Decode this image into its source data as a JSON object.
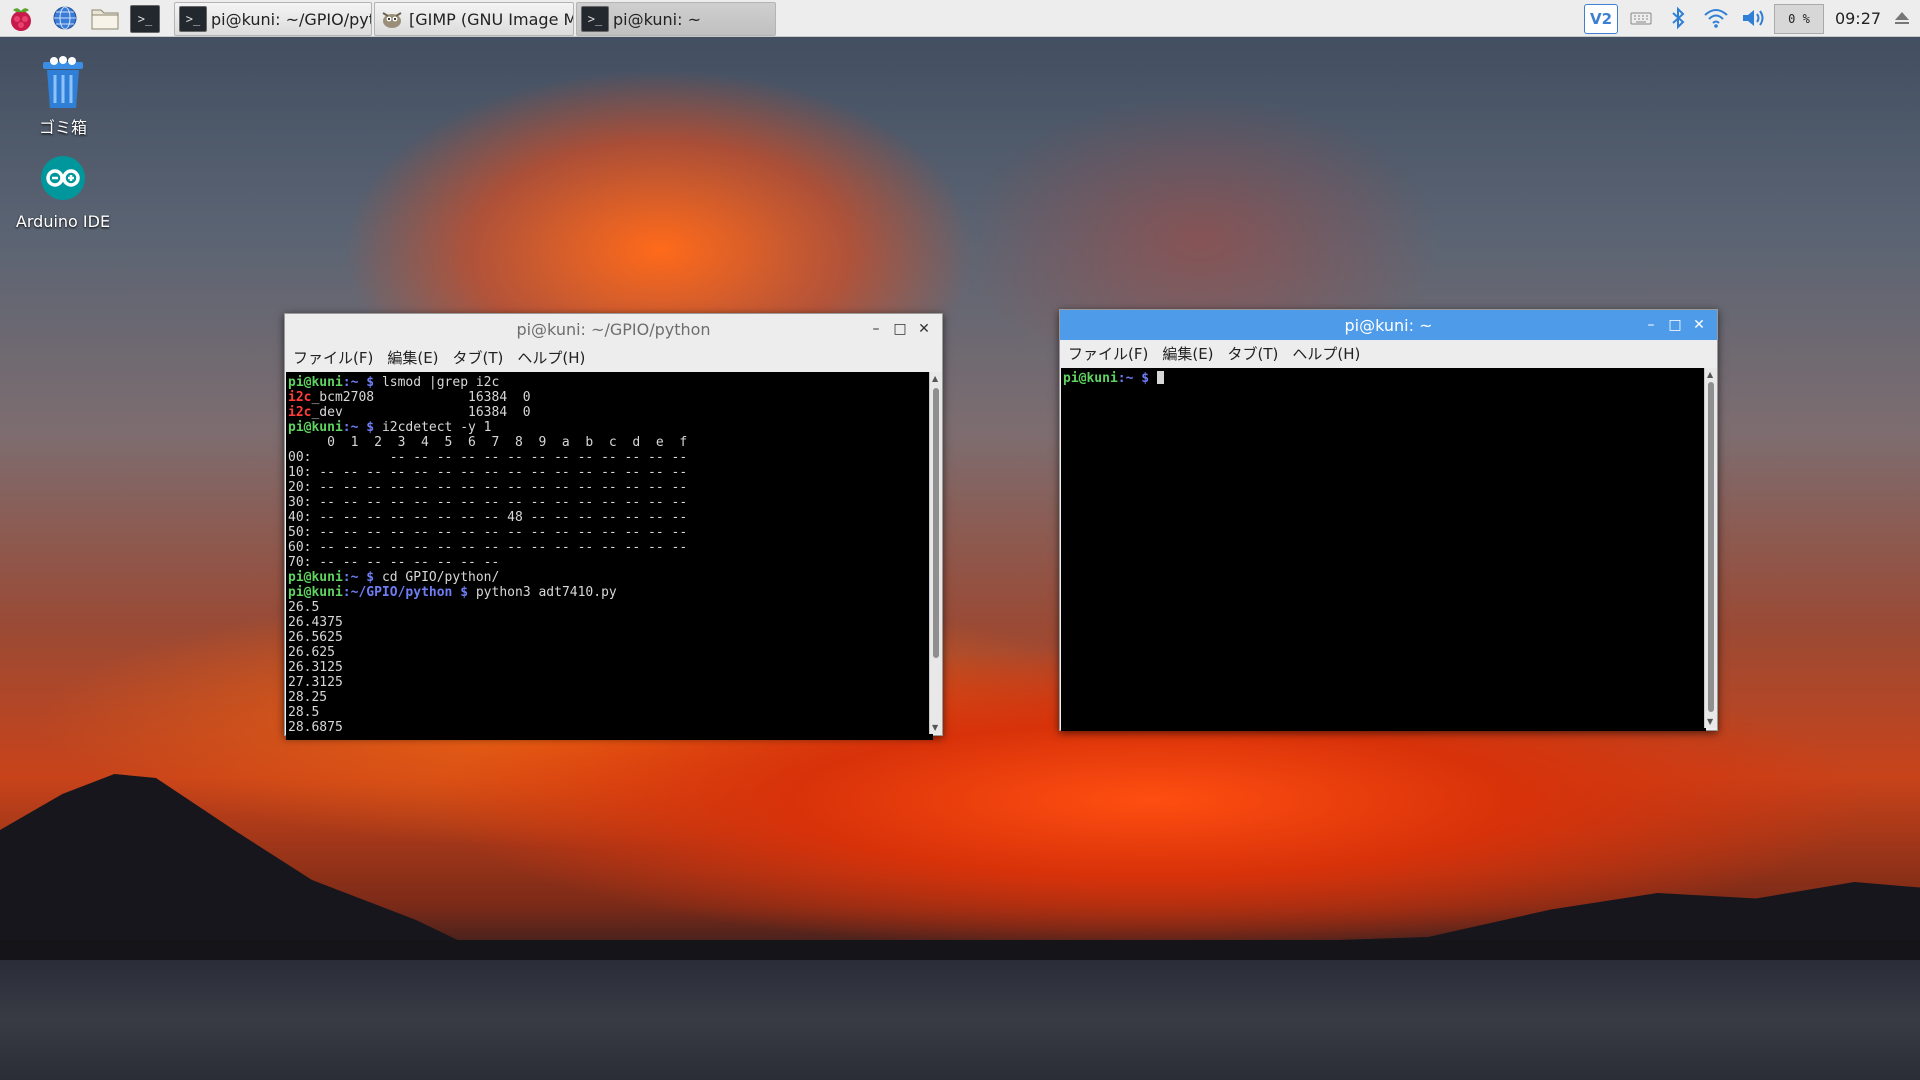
{
  "taskbar": {
    "launchers": [
      {
        "icon": "raspberry-menu-icon"
      },
      {
        "icon": "web-browser-icon"
      },
      {
        "icon": "file-manager-icon"
      },
      {
        "icon": "terminal-icon"
      }
    ],
    "tasks": [
      {
        "label": "pi@kuni: ~/GPIO/pyt...",
        "icon": "terminal-icon"
      },
      {
        "label": "[GIMP (GNU Image M...",
        "icon": "gimp-icon"
      },
      {
        "label": "pi@kuni: ~",
        "icon": "terminal-icon"
      }
    ],
    "tray": {
      "vnc_label": "V2",
      "cpu_label": "0 %",
      "clock": "09:27"
    }
  },
  "desktop": {
    "icons": [
      {
        "label": "ゴミ箱",
        "icon": "trash-icon"
      },
      {
        "label": "Arduino IDE",
        "icon": "arduino-icon"
      }
    ]
  },
  "window1": {
    "title": "pi@kuni: ~/GPIO/python",
    "menu": [
      "ファイル(F)",
      "編集(E)",
      "タブ(T)",
      "ヘルプ(H)"
    ],
    "lines": [
      {
        "prompt_user": "pi@kuni",
        "prompt_path": ":~",
        "prompt_sign": " $ ",
        "text": "lsmod |grep i2c"
      },
      {
        "hl": "i2c",
        "text": "_bcm2708            16384  0"
      },
      {
        "hl": "i2c",
        "text": "_dev                16384  0"
      },
      {
        "prompt_user": "pi@kuni",
        "prompt_path": ":~",
        "prompt_sign": " $ ",
        "text": "i2cdetect -y 1"
      },
      {
        "text": "     0  1  2  3  4  5  6  7  8  9  a  b  c  d  e  f"
      },
      {
        "text": "00:          -- -- -- -- -- -- -- -- -- -- -- -- --"
      },
      {
        "text": "10: -- -- -- -- -- -- -- -- -- -- -- -- -- -- -- --"
      },
      {
        "text": "20: -- -- -- -- -- -- -- -- -- -- -- -- -- -- -- --"
      },
      {
        "text": "30: -- -- -- -- -- -- -- -- -- -- -- -- -- -- -- --"
      },
      {
        "text": "40: -- -- -- -- -- -- -- -- 48 -- -- -- -- -- -- --"
      },
      {
        "text": "50: -- -- -- -- -- -- -- -- -- -- -- -- -- -- -- --"
      },
      {
        "text": "60: -- -- -- -- -- -- -- -- -- -- -- -- -- -- -- --"
      },
      {
        "text": "70: -- -- -- -- -- -- -- --"
      },
      {
        "prompt_user": "pi@kuni",
        "prompt_path": ":~",
        "prompt_sign": " $ ",
        "text": "cd GPIO/python/"
      },
      {
        "prompt_user": "pi@kuni",
        "prompt_path": ":~/GPIO/python",
        "prompt_sign": " $ ",
        "text": "python3 adt7410.py"
      },
      {
        "text": "26.5"
      },
      {
        "text": "26.4375"
      },
      {
        "text": "26.5625"
      },
      {
        "text": "26.625"
      },
      {
        "text": "26.3125"
      },
      {
        "text": "27.3125"
      },
      {
        "text": "28.25"
      },
      {
        "text": "28.5"
      },
      {
        "text": "28.6875"
      }
    ]
  },
  "window2": {
    "title": "pi@kuni: ~",
    "menu": [
      "ファイル(F)",
      "編集(E)",
      "タブ(T)",
      "ヘルプ(H)"
    ],
    "prompt_user": "pi@kuni",
    "prompt_path": ":~",
    "prompt_sign": " $ "
  },
  "colors": {
    "prompt_user": "#5fd35f",
    "prompt_path": "#6f7df5",
    "highlight": "#ff3d3d",
    "active_titlebar": "#4e9bea"
  }
}
